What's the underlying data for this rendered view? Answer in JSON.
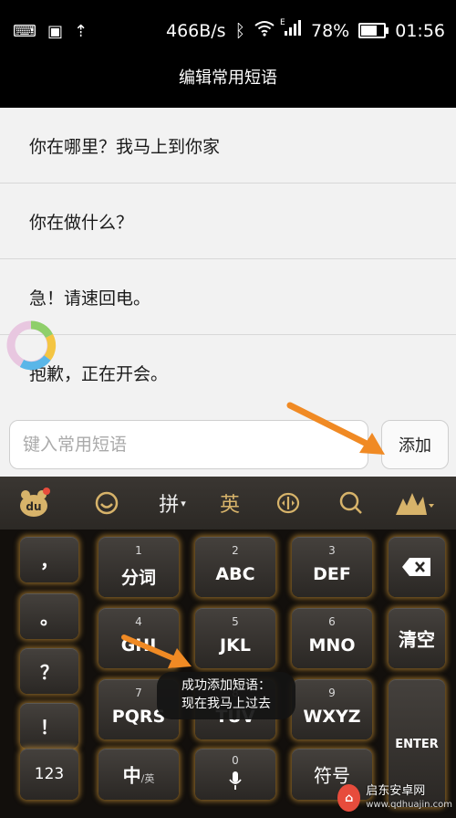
{
  "status_bar": {
    "net_speed": "466B/s",
    "battery": "78%",
    "battery_level": 0.78,
    "time": "01:56",
    "signal_label": "E"
  },
  "title": "编辑常用短语",
  "phrases": [
    "你在哪里？我马上到你家",
    "你在做什么？",
    "急！请速回电。",
    "抱歉，正在开会。"
  ],
  "input": {
    "placeholder": "键入常用短语",
    "value": ""
  },
  "add_button": "添加",
  "keyboard": {
    "toolbar": {
      "pinyin": "拼",
      "english": "英"
    },
    "left_column": [
      "，",
      "。",
      "？",
      "！"
    ],
    "keys": {
      "k1": {
        "num": "1",
        "label": "分词"
      },
      "k2": {
        "num": "2",
        "label": "ABC"
      },
      "k3": {
        "num": "3",
        "label": "DEF"
      },
      "k4": {
        "num": "4",
        "label": "GHI"
      },
      "k5": {
        "num": "5",
        "label": "JKL"
      },
      "k6": {
        "num": "6",
        "label": "MNO"
      },
      "k7": {
        "num": "7",
        "label": "PQRS"
      },
      "k8": {
        "num": "8",
        "label": "TUV"
      },
      "k9": {
        "num": "9",
        "label": "WXYZ"
      },
      "k0": {
        "num": "0"
      }
    },
    "clear": "清空",
    "enter": "ENTER",
    "num_mode": "123",
    "lang_main": "中",
    "lang_sub": "/英",
    "symbols": "符号"
  },
  "toast": {
    "line1": "成功添加短语：",
    "line2": "现在我马上过去"
  },
  "watermark": {
    "name": "启东安卓网",
    "url": "www.qdhuajin.com"
  },
  "colors": {
    "accent_gold": "#d7b36a",
    "arrow": "#f08a24",
    "glow": "#e6a53c"
  }
}
